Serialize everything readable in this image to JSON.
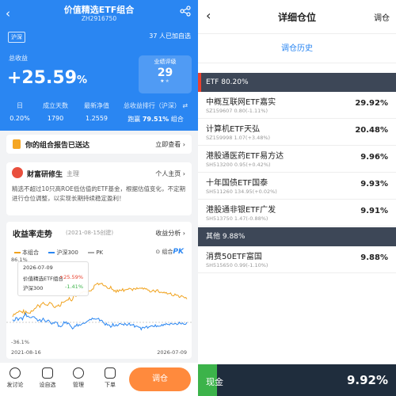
{
  "left": {
    "header": {
      "title": "价值精选ETF组合",
      "code": "ZH2916750",
      "market": "沪深",
      "followers": "37 人已加自选"
    },
    "profit": {
      "label": "总收益",
      "value": "+25.59",
      "unit": "%"
    },
    "rating": {
      "label": "业绩评级",
      "value": "29",
      "stars": 1.5
    },
    "stats": [
      {
        "label": "日",
        "value": "0.20%"
      },
      {
        "label": "成立天数",
        "value": "1790"
      },
      {
        "label": "最新净值",
        "value": "1.2559"
      },
      {
        "label": "总收益排行（沪深）",
        "value_prefix": "跑赢",
        "value": "79.51%",
        "value_suffix": "组合"
      }
    ],
    "report": {
      "text": "你的组合报告已送达",
      "action": "立即查看"
    },
    "mentor": {
      "name": "财富研修生",
      "role": "主理",
      "action": "个人主页",
      "desc": "精选不超过10只高ROE低估值的ETF基金，根据估值变化，不定期进行仓位调整，以实现长期持续稳定盈利！"
    },
    "trend": {
      "title": "收益率走势",
      "date": "(2021-08-15创建)",
      "action": "收益分析",
      "legend": [
        "本组合",
        "沪深300",
        "PK"
      ],
      "pk_label": "组合",
      "pk_badge": "PK",
      "tooltip": {
        "date": "2026-07-09",
        "row1_label": "价值精选ETF组合",
        "row1_value": "+25.59%",
        "row2_label": "沪深300",
        "row2_value": "-1.41%"
      },
      "y_top": "86.1%",
      "y_bottom": "-36.1%",
      "x_start": "2021-08-16",
      "x_end": "2026-07-09"
    },
    "bottom_nav": [
      "发讨论",
      "设自选",
      "管理",
      "下单"
    ],
    "trade_button": "调仓"
  },
  "right": {
    "header": {
      "title": "详细仓位",
      "action": "调仓"
    },
    "history": "调仓历史",
    "groups": [
      {
        "label": "ETF 80.20%",
        "items": [
          {
            "name": "中概互联网ETF嘉实",
            "code": "SZ159607 0.80(-1.11%)",
            "weight": "29.92%"
          },
          {
            "name": "计算机ETF天弘",
            "code": "SZ159998 1.07(+3.48%)",
            "weight": "20.48%"
          },
          {
            "name": "港股通医药ETF易方达",
            "code": "SH513200 0.95(+0.42%)",
            "weight": "9.96%"
          },
          {
            "name": "十年国债ETF国泰",
            "code": "SH511260 134.95(+0.02%)",
            "weight": "9.93%"
          },
          {
            "name": "港股通非银ETF广发",
            "code": "SH513750 1.47(-0.88%)",
            "weight": "9.91%"
          }
        ]
      },
      {
        "label": "其他 9.88%",
        "items": [
          {
            "name": "消费50ETF富国",
            "code": "SH515650 0.99(-1.10%)",
            "weight": "9.88%"
          }
        ]
      }
    ],
    "cash": {
      "label": "现金",
      "value": "9.92%"
    }
  },
  "colors": {
    "brand_blue": "#2a86f2",
    "portfolio_line": "#f0a21d",
    "index_line": "#2a86f2",
    "red": "#e9412f",
    "orange_button": "#ff8a3d",
    "group_header": "#3d4757",
    "cash_bg": "#1f2d3d",
    "cash_bar": "#3cb34a"
  }
}
